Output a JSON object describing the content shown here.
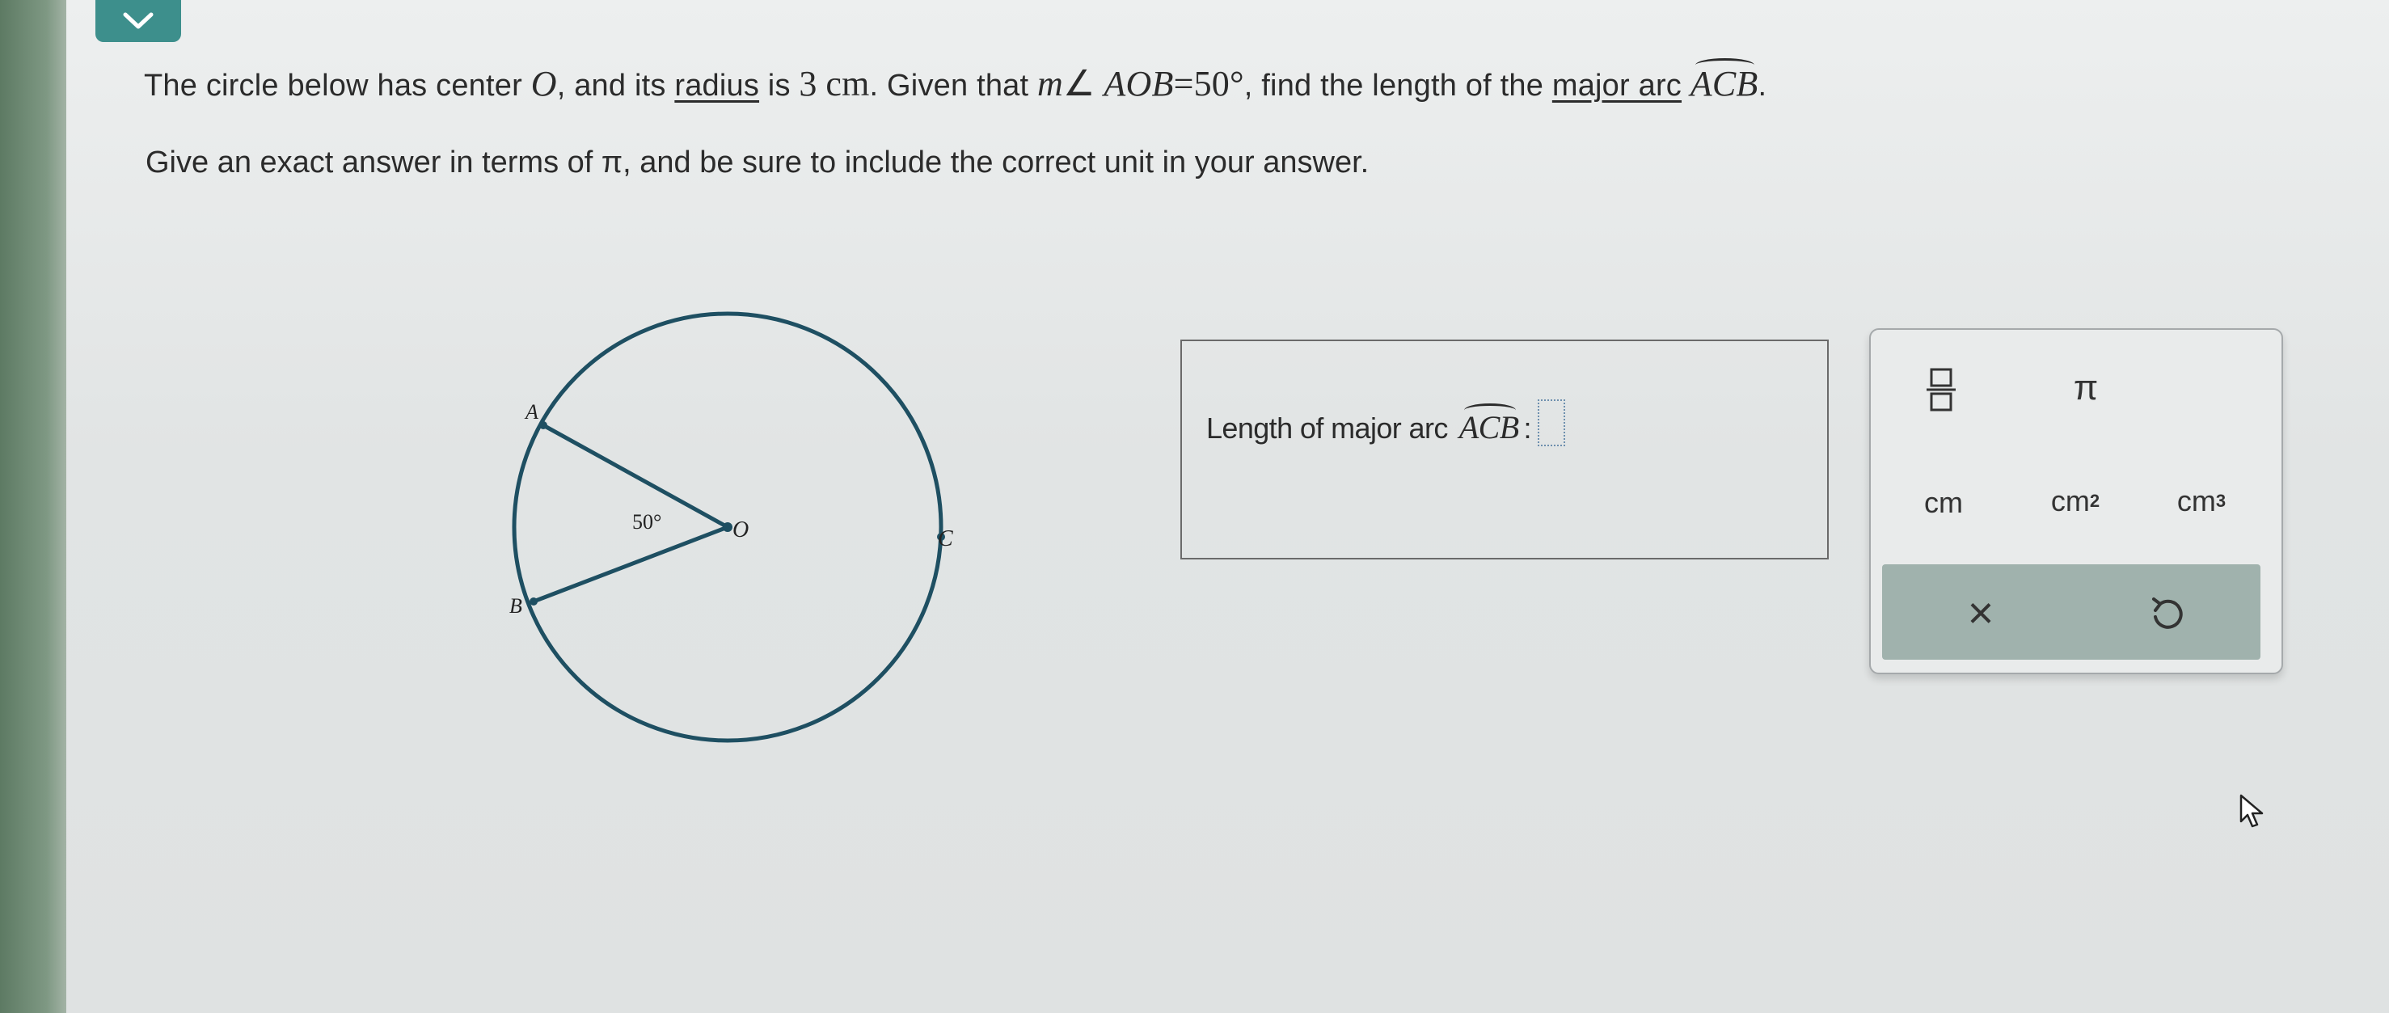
{
  "header": {
    "collapse_icon": "chevron-down-icon"
  },
  "question": {
    "t1": "The circle below has center ",
    "center": "O",
    "t2": ", and its ",
    "radius_link": "radius",
    "t3": " is ",
    "radius_value": "3",
    "radius_unit": "cm",
    "t4": ". Given that ",
    "angle_m": "m",
    "angle_sym": "∠",
    "angle_name": "AOB",
    "angle_eq": "=",
    "angle_value": "50°",
    "t5": ", find the length of the ",
    "major_arc_link": "major arc",
    "arc_name": "ACB",
    "t6": ".",
    "instruction": "Give an exact answer in terms of π, and be sure to include the correct unit in your answer."
  },
  "figure": {
    "label_a": "A",
    "label_b": "B",
    "label_c": "C",
    "label_o": "O",
    "angle_label": "50°"
  },
  "answer": {
    "label": "Length of major arc",
    "arc_name": "ACB",
    "colon": ":",
    "input_value": ""
  },
  "palette": {
    "fraction_icon": "fraction-icon",
    "pi": "π",
    "cm": "cm",
    "cm2": "cm",
    "cm2_exp": "2",
    "cm3": "cm",
    "cm3_exp": "3",
    "clear": "×",
    "undo_icon": "undo-icon"
  },
  "colors": {
    "accent": "#3d8f8c",
    "circle": "#1e4f62",
    "action_bar": "#a0b2ad"
  }
}
